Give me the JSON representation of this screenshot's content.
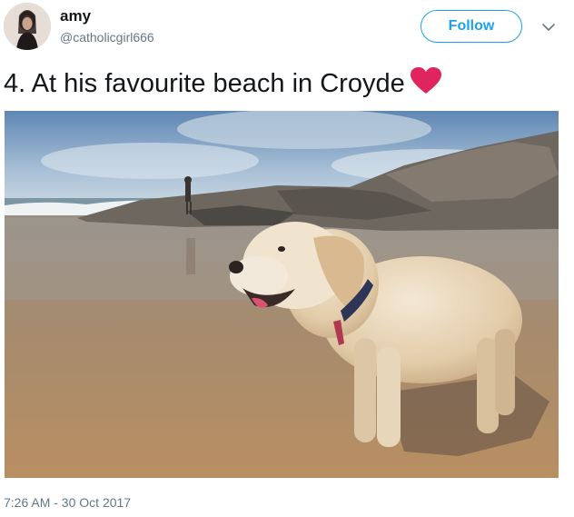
{
  "user": {
    "display_name": "amy",
    "handle": "@catholicgirl666"
  },
  "follow_label": "Follow",
  "tweet": {
    "text": "4. At his favourite beach in Croyde",
    "emoji": "red-heart-icon",
    "timestamp": "7:26 AM - 30 Oct 2017"
  },
  "colors": {
    "accent": "#1da1f2",
    "heart": "#e0245e",
    "secondary_text": "#657786"
  }
}
